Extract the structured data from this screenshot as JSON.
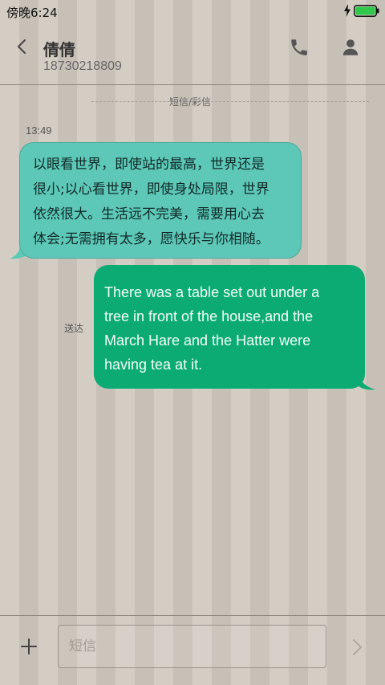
{
  "status_bar": {
    "time": "傍晚6:24",
    "bolt_icon": "charging-bolt-icon",
    "battery_icon": "battery-icon",
    "battery_color": "#2fc84b"
  },
  "header": {
    "back_icon": "chevron-left-icon",
    "contact_name": "倩倩",
    "contact_number": "18730218809",
    "phone_icon": "phone-icon",
    "profile_icon": "person-icon"
  },
  "conversation": {
    "divider_label": "短信/彩信",
    "timestamp": "13:49",
    "incoming_message": {
      "lines": [
        "以眼看世界，即使站的最高，世界还是",
        "很小;以心看世界，即使身处局限，世界",
        "依然很大。生活远不完美，需要用心去",
        "体会;无需拥有太多，愿快乐与你相随。"
      ],
      "color": "#5ec8b8"
    },
    "outgoing_message": {
      "status": "送达",
      "lines": [
        "There was a table set out under a",
        "tree in front of the house,and the",
        "March Hare and the Hatter were",
        "having tea at it."
      ],
      "color": "#0dab74"
    }
  },
  "composer": {
    "add_icon": "plus-icon",
    "input_placeholder": "短信",
    "input_value": "",
    "send_icon": "chevron-right-icon"
  }
}
